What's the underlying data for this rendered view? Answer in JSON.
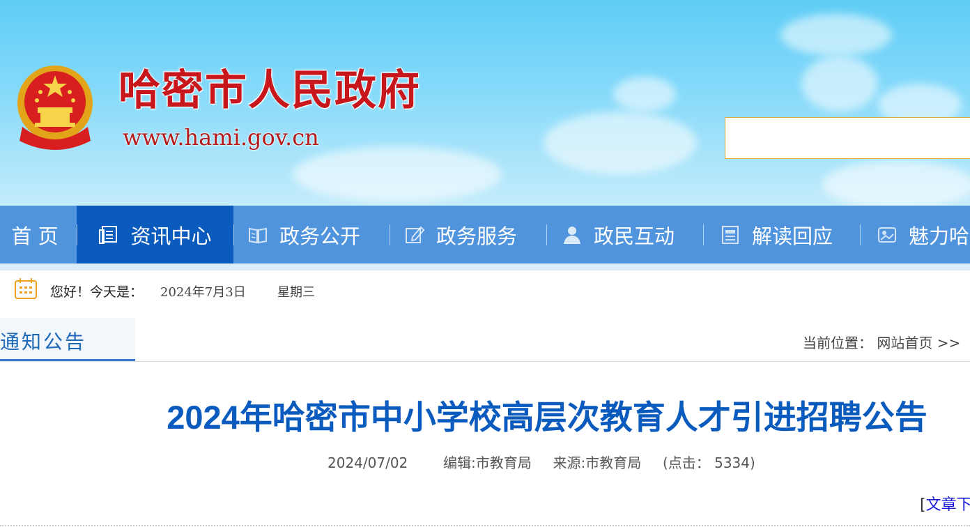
{
  "header": {
    "site_title": "哈密市人民政府",
    "site_url": "www.hami.gov.cn",
    "search": {
      "value": "",
      "placeholder": ""
    }
  },
  "nav": {
    "items": [
      {
        "label": "首 页",
        "icon": "none"
      },
      {
        "label": "资讯中心",
        "icon": "news-icon",
        "active": true
      },
      {
        "label": "政务公开",
        "icon": "book-icon"
      },
      {
        "label": "政务服务",
        "icon": "edit-icon"
      },
      {
        "label": "政民互动",
        "icon": "person-icon"
      },
      {
        "label": "解读回应",
        "icon": "document-icon"
      },
      {
        "label": "魅力哈",
        "icon": "image-icon"
      }
    ]
  },
  "date_bar": {
    "greeting": "您好！今天是：",
    "date": "2024年7月3日",
    "weekday": "星期三"
  },
  "section": {
    "tab_label": "通知公告",
    "breadcrumb_prefix": "当前位置：",
    "breadcrumb_home": "网站首页",
    "breadcrumb_sep": ">>"
  },
  "article": {
    "title": "2024年哈密市中小学校高层次教育人才引进招聘公告",
    "date": "2024/07/02",
    "editor": "编辑:市教育局",
    "source": "来源:市教育局",
    "clicks": "(点击： 5334)",
    "download_link": "文章下",
    "bracket_open": "["
  },
  "colors": {
    "nav_bg": "#4f94dd",
    "nav_active": "#0a5bbd",
    "title_red": "#c8161d",
    "article_title_blue": "#0a5bbd"
  }
}
